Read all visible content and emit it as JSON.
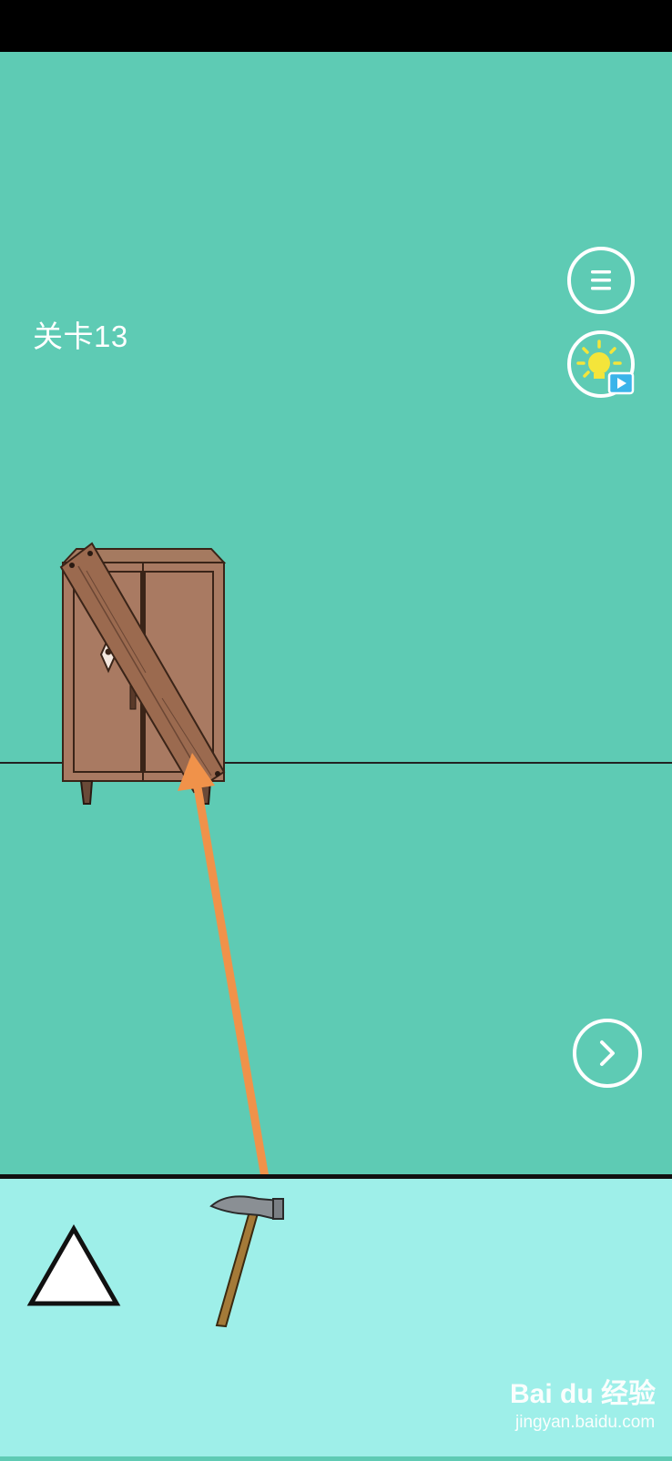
{
  "status_bar": {},
  "hud": {
    "level_title": "关卡13",
    "menu_icon": "hamburger-menu-icon",
    "hint_icon": "lightbulb-video-hint-icon",
    "next_icon": "chevron-right-icon"
  },
  "scene": {
    "objects": [
      "wooden-cabinet",
      "nailed-wooden-plank",
      "diamond-keyhole"
    ],
    "annotation": "orange-arrow"
  },
  "inventory": {
    "items": [
      "triangle-shape",
      "hammer"
    ]
  },
  "watermark": {
    "logo": "Bai du 经验",
    "url": "jingyan.baidu.com"
  },
  "colors": {
    "scene_bg": "#5ecbb4",
    "inventory_bg": "#9eefe9",
    "cabinet": "#a97a62",
    "plank": "#9b6a4f",
    "arrow": "#f0924a",
    "bulb": "#f4e53a",
    "video_badge": "#3ab4ea"
  }
}
